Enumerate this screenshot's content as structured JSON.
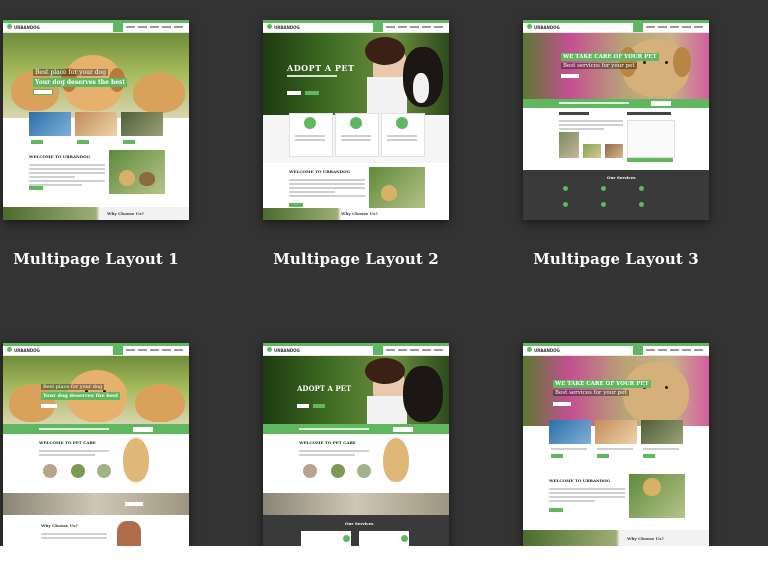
{
  "layouts": [
    {
      "title": "Multipage Layout 1",
      "logo": "URBANDOG",
      "hero_line1": "Best place for your dog",
      "hero_line2": "Your dog deserves the best",
      "welcome": "WELCOME TO URBANDOG",
      "bottom_label": "Why Choose Us?"
    },
    {
      "title": "Multipage Layout 2",
      "logo": "URBANDOG",
      "hero_line1": "ADOPT A PET",
      "welcome": "WELCOME TO URBANDOG",
      "bottom_label": "Why Choose Us?"
    },
    {
      "title": "Multipage Layout 3",
      "logo": "URBANDOG",
      "hero_line1": "WE TAKE CARE OF YOUR PET",
      "hero_line2": "Best services for your pet",
      "services_label": "Our Services"
    },
    {
      "title": "",
      "logo": "URBANDOG",
      "hero_line1": "Best place for your dog",
      "hero_line2": "Your dog deserves the best",
      "welcome": "WELCOME TO PET CARE",
      "bottom_label": "Why Choose Us?"
    },
    {
      "title": "",
      "logo": "URBANDOG",
      "hero_line1": "ADOPT A PET",
      "welcome": "WELCOME TO PET CARE",
      "services_label": "Our Services"
    },
    {
      "title": "",
      "logo": "URBANDOG",
      "hero_line1": "WE TAKE CARE OF YOUR PET",
      "hero_line2": "Best services for your pet",
      "welcome": "WELCOME TO URBANDOG",
      "bottom_label": "Why Choose Us?"
    }
  ],
  "colors": {
    "background": "#333333",
    "accent": "#5fb760",
    "caption": "#ffffff"
  }
}
